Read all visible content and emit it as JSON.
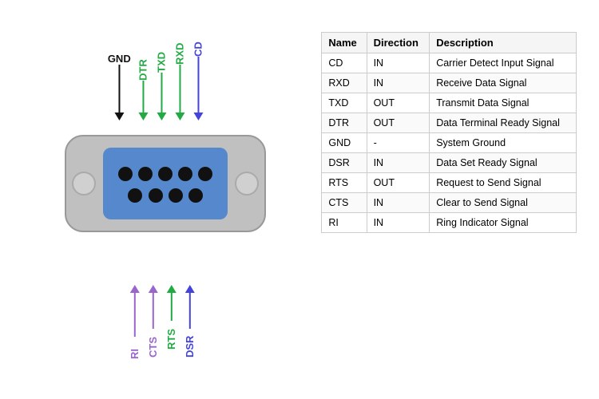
{
  "table": {
    "headers": [
      "Name",
      "Direction",
      "Description"
    ],
    "rows": [
      [
        "CD",
        "IN",
        "Carrier Detect Input Signal"
      ],
      [
        "RXD",
        "IN",
        "Receive Data Signal"
      ],
      [
        "TXD",
        "OUT",
        "Transmit Data Signal"
      ],
      [
        "DTR",
        "OUT",
        "Data Terminal Ready Signal"
      ],
      [
        "GND",
        "-",
        "System Ground"
      ],
      [
        "DSR",
        "IN",
        "Data Set Ready Signal"
      ],
      [
        "RTS",
        "OUT",
        "Request to Send Signal"
      ],
      [
        "CTS",
        "IN",
        "Clear to Send Signal"
      ],
      [
        "RI",
        "IN",
        "Ring Indicator Signal"
      ]
    ]
  },
  "signals": {
    "top": [
      {
        "name": "GND",
        "color": "#111111"
      },
      {
        "name": "DTR",
        "color": "#22aa44"
      },
      {
        "name": "TXD",
        "color": "#22aa44"
      },
      {
        "name": "RXD",
        "color": "#22aa44"
      },
      {
        "name": "CD",
        "color": "#4444dd"
      }
    ],
    "bottom": [
      {
        "name": "RI",
        "color": "#9966cc"
      },
      {
        "name": "CTS",
        "color": "#9966cc"
      },
      {
        "name": "RTS",
        "color": "#22aa44"
      },
      {
        "name": "DSR",
        "color": "#4444dd"
      }
    ]
  }
}
